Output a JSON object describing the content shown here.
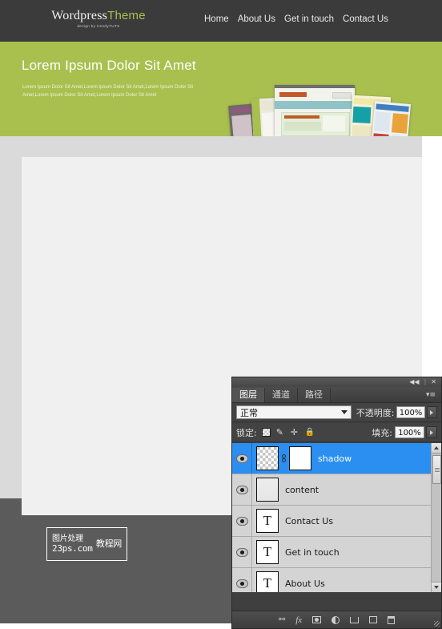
{
  "site": {
    "logo": {
      "part1": "Wordpress",
      "part2": "Theme",
      "tagline": "design by trendyTUTS"
    },
    "nav": [
      {
        "label": "Home"
      },
      {
        "label": "About Us"
      },
      {
        "label": "Get in touch"
      },
      {
        "label": "Contact Us"
      }
    ],
    "hero": {
      "heading": "Lorem Ipsum Dolor Sit Amet",
      "body": "Lorem Ipsum Dolor Sit Amet,Lorem Ipsum Dolor Sit Amet,Lorem Ipsum Dolor Sit Amet,Lorem Ipsum Dolor Sit Amet,Lorem Ipsum Dolor Sit Amet"
    },
    "watermark": {
      "line1": "图片处理",
      "line2": "23ps.com",
      "line3": "教程网"
    },
    "colors": {
      "green": "#a9c04f",
      "dark_bar": "#3b3b3b",
      "gray_band": "#dadada",
      "content": "#f0f0f0",
      "footer": "#5b5b5b"
    }
  },
  "photoshop": {
    "window": {
      "collapse_icon": "◀◀",
      "separator": "|",
      "close_icon": "✕"
    },
    "tabs": [
      {
        "label": "图层",
        "active": true
      },
      {
        "label": "通道",
        "active": false
      },
      {
        "label": "路径",
        "active": false
      }
    ],
    "panel_menu_icon": "panel-menu-icon",
    "blend": {
      "value": "正常",
      "opacity_label": "不透明度:",
      "opacity_value": "100%"
    },
    "lock": {
      "label": "锁定:",
      "fill_label": "填充:",
      "fill_value": "100%",
      "icons": [
        "transparency-lock-icon",
        "brush-lock-icon",
        "move-lock-icon",
        "lock-all-icon"
      ]
    },
    "layers": [
      {
        "name": "shadow",
        "selected": true,
        "thumb": "checker",
        "has_mask": true,
        "visible": true
      },
      {
        "name": "content",
        "selected": false,
        "thumb": "faint",
        "has_mask": false,
        "visible": true
      },
      {
        "name": "Contact Us",
        "selected": false,
        "thumb": "text",
        "thumb_glyph": "T",
        "has_mask": false,
        "visible": true
      },
      {
        "name": "Get in touch",
        "selected": false,
        "thumb": "text",
        "thumb_glyph": "T",
        "has_mask": false,
        "visible": true
      },
      {
        "name": "About Us",
        "selected": false,
        "thumb": "text",
        "thumb_glyph": "T",
        "has_mask": false,
        "visible": true
      }
    ],
    "footer_icons": [
      {
        "name": "link-layers-icon",
        "glyph": "⚯"
      },
      {
        "name": "layer-style-fx-icon",
        "glyph": "fx"
      },
      {
        "name": "add-layer-mask-icon",
        "glyph": ""
      },
      {
        "name": "adjustment-layer-icon",
        "glyph": ""
      },
      {
        "name": "new-group-icon",
        "glyph": ""
      },
      {
        "name": "new-layer-icon",
        "glyph": ""
      },
      {
        "name": "delete-layer-icon",
        "glyph": ""
      }
    ]
  }
}
